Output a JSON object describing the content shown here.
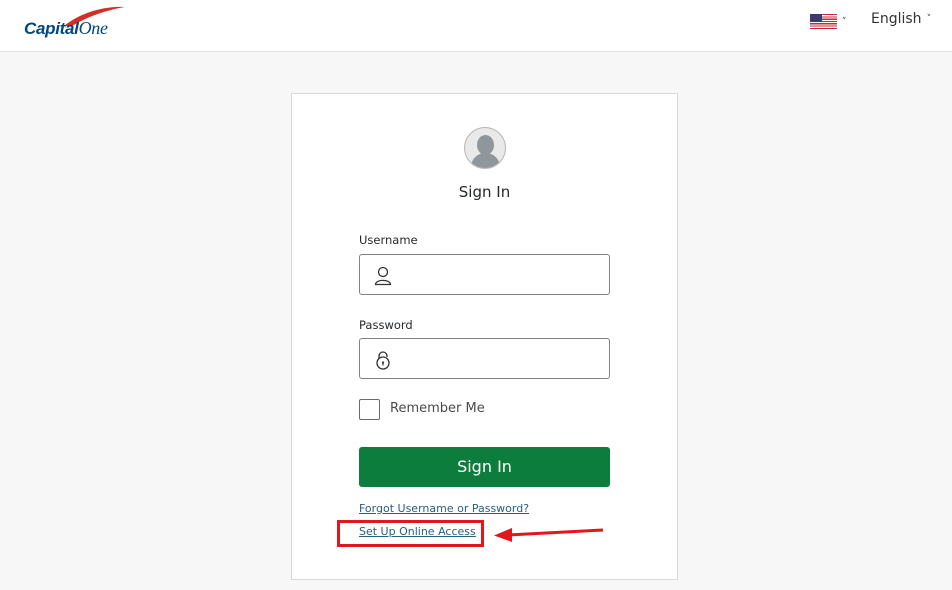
{
  "header": {
    "logo": {
      "brand": "Capital",
      "brand_suffix": "One",
      "icon": "capital-one-swoosh-logo"
    },
    "country_selector": {
      "icon": "us-flag-icon",
      "chevron": "˅"
    },
    "language_selector": {
      "value": "English",
      "chevron": "˅"
    }
  },
  "signin_card": {
    "avatar_icon": "user-avatar-icon",
    "title": "Sign In",
    "username": {
      "label": "Username",
      "value": "",
      "placeholder": "",
      "icon": "user-icon"
    },
    "password": {
      "label": "Password",
      "value": "",
      "placeholder": "",
      "icon": "lock-icon"
    },
    "remember_me": {
      "label": "Remember Me",
      "checked": false
    },
    "submit_label": "Sign In",
    "links": {
      "forgot": "Forgot Username or Password?",
      "setup": "Set Up Online Access"
    }
  },
  "annotation": {
    "highlight_color": "#e2161b",
    "target": "Set Up Online Access"
  },
  "colors": {
    "brand_blue": "#004879",
    "brand_red": "#d03027",
    "primary_button": "#0d7d3e",
    "link": "#255f82"
  }
}
